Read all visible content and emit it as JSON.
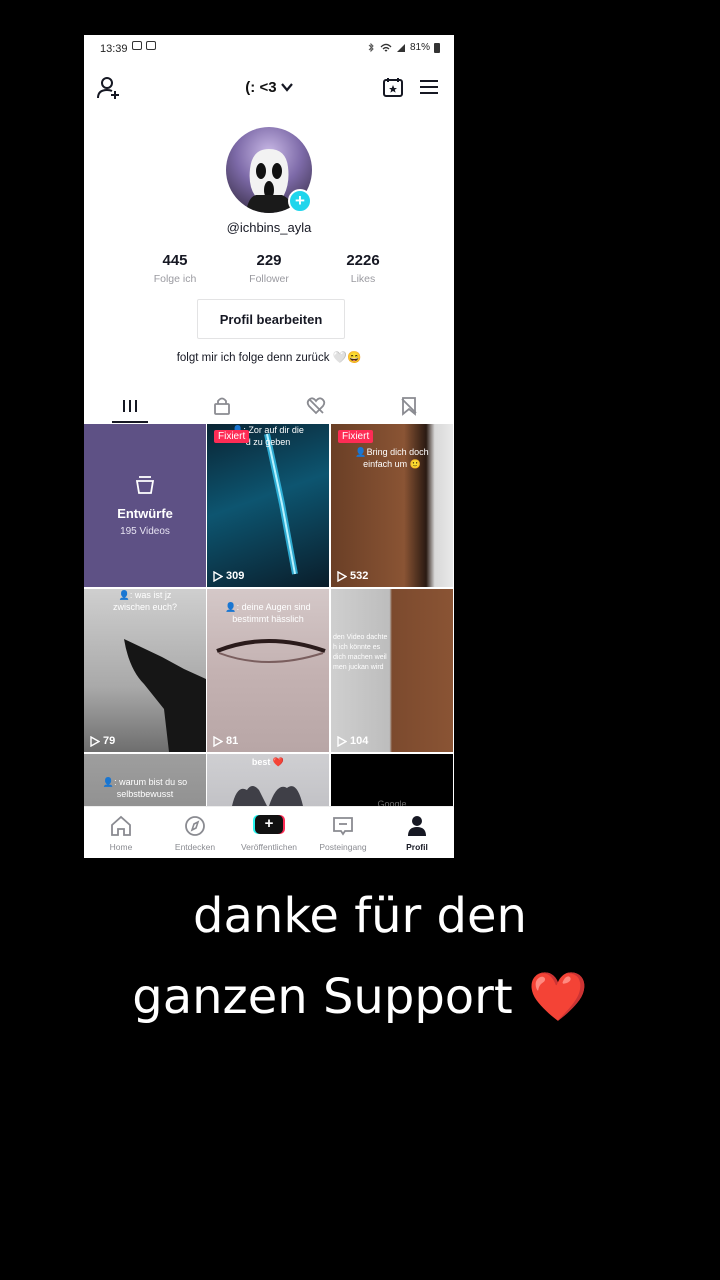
{
  "status_bar": {
    "time": "13:39",
    "battery": "81%"
  },
  "header": {
    "title": "(: <3"
  },
  "profile": {
    "handle": "@ichbins_ayla",
    "stats": [
      {
        "value": "445",
        "label": "Folge ich"
      },
      {
        "value": "229",
        "label": "Follower"
      },
      {
        "value": "2226",
        "label": "Likes"
      }
    ],
    "edit_button": "Profil bearbeiten",
    "bio": "folgt mir ich folge denn zurück 🤍😄"
  },
  "tabs": [
    "videos-grid-icon",
    "lock-icon",
    "liked-icon",
    "bookmark-icon"
  ],
  "grid": {
    "drafts": {
      "title": "Entwürfe",
      "subtitle": "195 Videos"
    },
    "videos": [
      {
        "badge": "Fixiert",
        "views": "309",
        "caption": "👤: Zor auf dir die\nd zu geben"
      },
      {
        "badge": "Fixiert",
        "views": "532",
        "caption": "👤Bring dich doch\neinfach um 🙂"
      },
      {
        "badge": "",
        "views": "79",
        "caption": "👤: was ist jz\nzwischen euch?"
      },
      {
        "badge": "",
        "views": "81",
        "caption": "👤: deine Augen sind\nbestimmt hässlich"
      },
      {
        "badge": "",
        "views": "104",
        "caption": "den Video dachte\nh ich könnte es\ndich machen weil\nmen juckan wird"
      },
      {
        "badge": "",
        "views": "",
        "caption": "👤: warum bist du so\nselbstbewusst"
      },
      {
        "badge": "",
        "views": "",
        "caption": "best ❤️"
      },
      {
        "badge": "",
        "views": "",
        "caption": "Google"
      }
    ]
  },
  "bottom_nav": [
    {
      "label": "Home",
      "icon": "home-icon"
    },
    {
      "label": "Entdecken",
      "icon": "compass-icon"
    },
    {
      "label": "Veröffentlichen",
      "icon": "create-icon"
    },
    {
      "label": "Posteingang",
      "icon": "inbox-icon"
    },
    {
      "label": "Profil",
      "icon": "profile-icon"
    }
  ],
  "overlay_caption": {
    "line1": "danke für den",
    "line2": "ganzen Support",
    "emoji": "❤️"
  },
  "colors": {
    "accent_red": "#fe2c55",
    "accent_cyan": "#20d5ec",
    "drafts_bg": "#5e5185"
  }
}
